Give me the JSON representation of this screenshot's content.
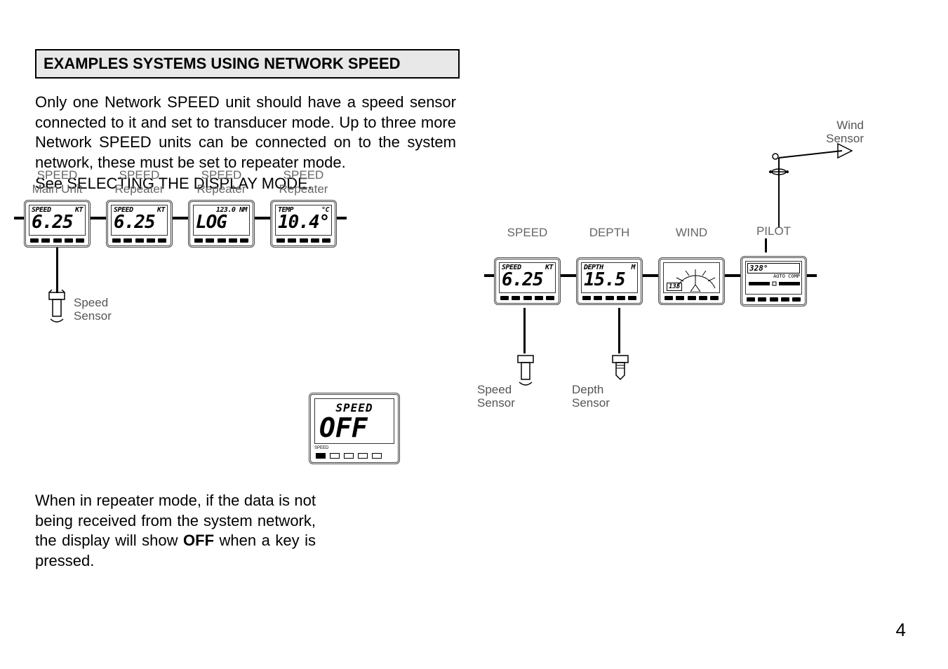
{
  "heading": "EXAMPLES SYSTEMS USING NETWORK SPEED",
  "para1": "Only one Network SPEED unit should have a speed sensor connected to it and set to transducer mode. Up to three more Network SPEED units can be connected on to the system network, these must be set to repeater mode.",
  "para2": "See SELECTING THE DISPLAY MODE.",
  "left": {
    "units": [
      {
        "label1": "SPEED",
        "label2": "Main Unit",
        "top_left": "SPEED",
        "top_right": "KT",
        "value": "6.25"
      },
      {
        "label1": "SPEED",
        "label2": "Repeater",
        "top_left": "SPEED",
        "top_right": "KT",
        "value": "6.25"
      },
      {
        "label1": "SPEED",
        "label2": "Repeater",
        "top_left": "",
        "top_right": "123.0 NM",
        "value": "LOG"
      },
      {
        "label1": "SPEED",
        "label2": "Repeater",
        "top_left": "TEMP",
        "top_right": "°C",
        "value": "10.4°"
      }
    ],
    "sensor_label": "Speed\nSensor"
  },
  "off": {
    "title": "SPEED",
    "value": "OFF",
    "btn_label": "SPEED"
  },
  "para3a": "When in repeater mode, if the data is not being received from the system network, the display will show ",
  "para3b": "OFF",
  "para3c": " when a key is pressed.",
  "right": {
    "wind_sensor_label": "Wind\nSensor",
    "units": [
      {
        "label1": "SPEED",
        "top_left": "SPEED",
        "top_right": "KT",
        "value": "6.25"
      },
      {
        "label1": "DEPTH",
        "top_left": "DEPTH",
        "top_right": "M",
        "value": "15.5"
      },
      {
        "label1": "WIND",
        "wind_value": "135"
      },
      {
        "label1": "PILOT",
        "pilot_hdg": "328°",
        "pilot_mode": "AUTO COMP"
      }
    ],
    "sensors": [
      {
        "label": "Speed\nSensor"
      },
      {
        "label": "Depth\nSensor"
      }
    ]
  },
  "page_num": "4"
}
